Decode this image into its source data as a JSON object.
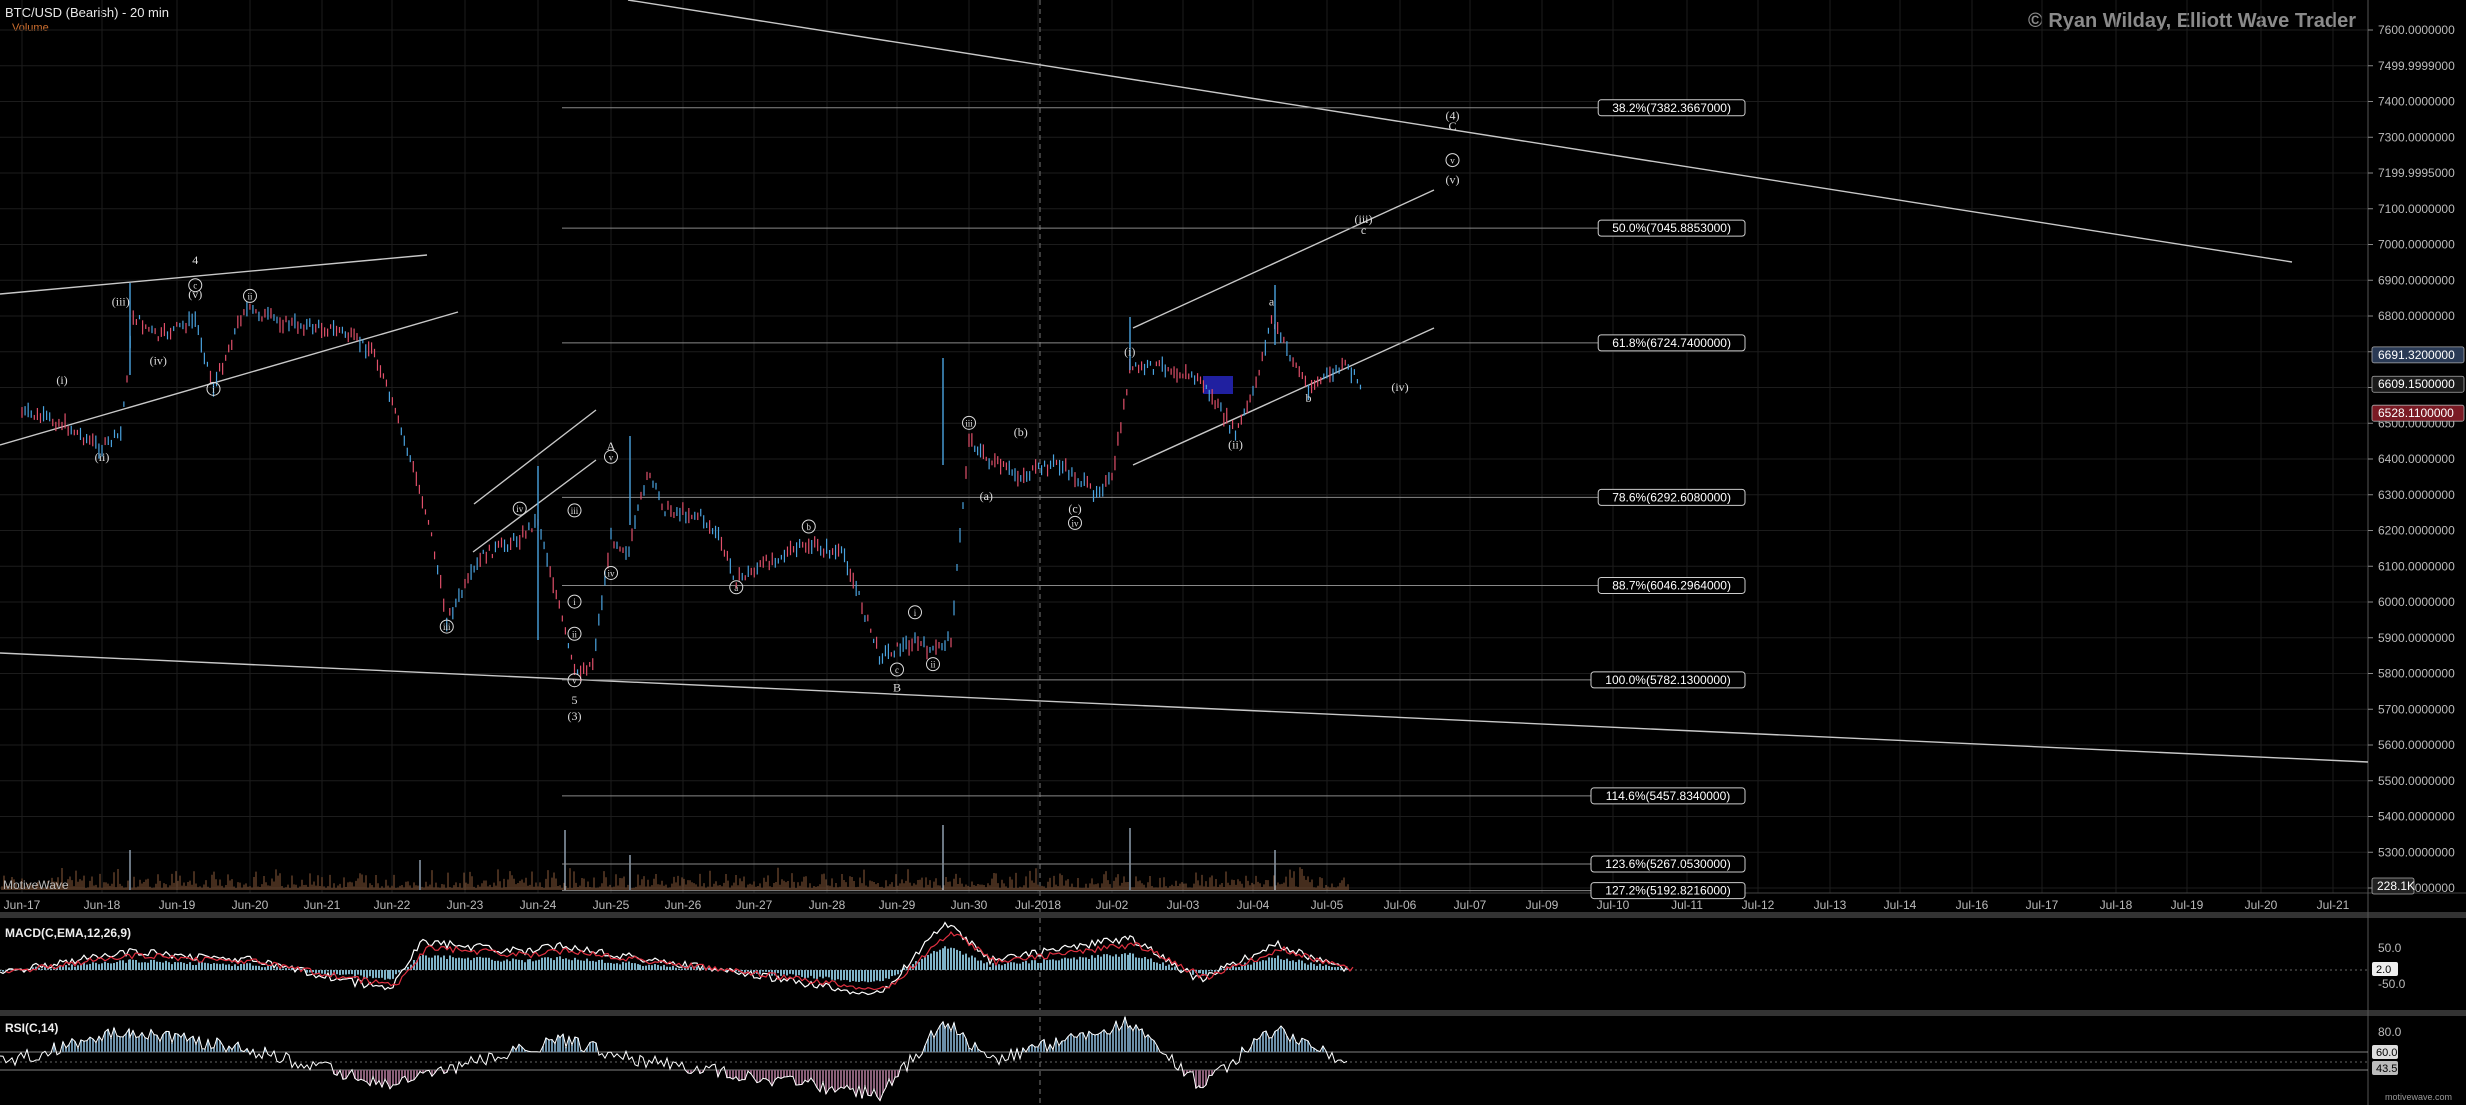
{
  "header": {
    "symbol_title": "BTC/USD (Bearish) - 20 min",
    "volume_label": "Volume",
    "watermark": "© Ryan Wilday, Elliott Wave Trader",
    "brand": "MotiveWave",
    "footer_brand": "motivewave.com"
  },
  "colors": {
    "background": "#000000",
    "grid": "#1c1c1c",
    "candle_up": "#4aa3df",
    "candle_down": "#e0506a",
    "line": "#c8c8c8",
    "fib_text": "#ffffff",
    "macd_line": "#ffffff",
    "macd_signal": "#e03040",
    "macd_hist": "#7fb3c8",
    "rsi_line": "#ffffff",
    "rsi_fill_high": "#6b8fa8",
    "rsi_fill_low": "#8a5f78",
    "volume": "#8a5a3a",
    "blue_box": "#2020a0",
    "price_tag_up": "#2a3a55",
    "price_tag_down": "#7a1a24"
  },
  "chart_data": [
    {
      "type": "line",
      "title": "BTC/USD (Bearish) - 20 min",
      "x_ticks": [
        "Jun-17",
        "Jun-18",
        "Jun-19",
        "Jun-20",
        "Jun-21",
        "Jun-22",
        "Jun-23",
        "Jun-24",
        "Jun-25",
        "Jun-26",
        "Jun-27",
        "Jun-28",
        "Jun-29",
        "Jun-30",
        "Jul-2018",
        "Jul-02",
        "Jul-03",
        "Jul-04",
        "Jul-05",
        "Jul-06",
        "Jul-07",
        "Jul-09",
        "Jul-10",
        "Jul-11",
        "Jul-12",
        "Jul-13",
        "Jul-14",
        "Jul-16",
        "Jul-17",
        "Jul-18",
        "Jul-19",
        "Jul-20",
        "Jul-21"
      ],
      "y_ticks": [
        "7600.0000000",
        "7499.9999000",
        "7400.0000000",
        "7300.0000000",
        "7199.9995000",
        "7100.0000000",
        "7000.0000000",
        "6900.0000000",
        "6800.0000000",
        "6700.0000000",
        "6600.0000000",
        "6500.0000000",
        "6400.0000000",
        "6300.0000000",
        "6200.0000000",
        "6100.0000000",
        "6000.0000000",
        "5900.0000000",
        "5800.0000000",
        "5700.0000000",
        "5600.0000000",
        "5500.0000000",
        "5400.0000000",
        "5300.0000000",
        "5200.0000000"
      ],
      "ylim": [
        5180,
        7640
      ],
      "price_tags": [
        {
          "value": 6691.32,
          "label": "6691.3200000"
        },
        {
          "value": 6609.15,
          "label": "6609.1500000"
        },
        {
          "value": 6528.11,
          "label": "6528.1100000"
        }
      ],
      "volume_tag": "228.1K",
      "fib_levels": [
        {
          "price": 7382.3667,
          "label": "38.2%(7382.3667000)"
        },
        {
          "price": 7045.8853,
          "label": "50.0%(7045.8853000)"
        },
        {
          "price": 6724.74,
          "label": "61.8%(6724.7400000)"
        },
        {
          "price": 6292.608,
          "label": "78.6%(6292.6080000)"
        },
        {
          "price": 6046.2964,
          "label": "88.7%(6046.2964000)"
        },
        {
          "price": 5782.13,
          "label": "100.0%(5782.1300000)"
        },
        {
          "price": 5457.834,
          "label": "114.6%(5457.8340000)"
        },
        {
          "price": 5267.053,
          "label": "123.6%(5267.0530000)"
        },
        {
          "price": 5192.8216,
          "label": "127.2%(5192.8216000)"
        }
      ],
      "price_path": [
        {
          "x": "Jun-17 00:00",
          "y": 6530
        },
        {
          "x": "Jun-17 12:00",
          "y": 6500
        },
        {
          "x": "Jun-18 00:00",
          "y": 6430
        },
        {
          "x": "Jun-18 06:00",
          "y": 6470
        },
        {
          "x": "Jun-18 10:00",
          "y": 6800
        },
        {
          "x": "Jun-18 18:00",
          "y": 6740
        },
        {
          "x": "Jun-19 06:00",
          "y": 6790
        },
        {
          "x": "Jun-19 12:00",
          "y": 6600
        },
        {
          "x": "Jun-19 22:00",
          "y": 6820
        },
        {
          "x": "Jun-20 12:00",
          "y": 6780
        },
        {
          "x": "Jun-21 06:00",
          "y": 6760
        },
        {
          "x": "Jun-21 18:00",
          "y": 6700
        },
        {
          "x": "Jun-22 06:00",
          "y": 6400
        },
        {
          "x": "Jun-22 12:00",
          "y": 6230
        },
        {
          "x": "Jun-22 18:00",
          "y": 5950
        },
        {
          "x": "Jun-23 06:00",
          "y": 6130
        },
        {
          "x": "Jun-23 18:00",
          "y": 6180
        },
        {
          "x": "Jun-24 00:00",
          "y": 6230
        },
        {
          "x": "Jun-24 06:00",
          "y": 6020
        },
        {
          "x": "Jun-24 12:00",
          "y": 5800
        },
        {
          "x": "Jun-24 18:00",
          "y": 5830
        },
        {
          "x": "Jun-25 00:00",
          "y": 6180
        },
        {
          "x": "Jun-25 06:00",
          "y": 6140
        },
        {
          "x": "Jun-25 12:00",
          "y": 6360
        },
        {
          "x": "Jun-25 18:00",
          "y": 6260
        },
        {
          "x": "Jun-26 06:00",
          "y": 6240
        },
        {
          "x": "Jun-26 12:00",
          "y": 6180
        },
        {
          "x": "Jun-26 18:00",
          "y": 6060
        },
        {
          "x": "Jun-27 06:00",
          "y": 6120
        },
        {
          "x": "Jun-27 18:00",
          "y": 6160
        },
        {
          "x": "Jun-28 06:00",
          "y": 6130
        },
        {
          "x": "Jun-28 12:00",
          "y": 5990
        },
        {
          "x": "Jun-28 18:00",
          "y": 5850
        },
        {
          "x": "Jun-29 06:00",
          "y": 5890
        },
        {
          "x": "Jun-29 12:00",
          "y": 5860
        },
        {
          "x": "Jun-29 18:00",
          "y": 5900
        },
        {
          "x": "Jun-30 00:00",
          "y": 6460
        },
        {
          "x": "Jun-30 06:00",
          "y": 6400
        },
        {
          "x": "Jun-30 18:00",
          "y": 6350
        },
        {
          "x": "Jul-2018 06:00",
          "y": 6390
        },
        {
          "x": "Jul-2018 18:00",
          "y": 6310
        },
        {
          "x": "Jul-02 00:00",
          "y": 6340
        },
        {
          "x": "Jul-02 06:00",
          "y": 6650
        },
        {
          "x": "Jul-02 18:00",
          "y": 6660
        },
        {
          "x": "Jul-03 06:00",
          "y": 6620
        },
        {
          "x": "Jul-03 18:00",
          "y": 6470
        },
        {
          "x": "Jul-04 00:00",
          "y": 6580
        },
        {
          "x": "Jul-04 06:00",
          "y": 6790
        },
        {
          "x": "Jul-04 12:00",
          "y": 6690
        },
        {
          "x": "Jul-04 18:00",
          "y": 6600
        },
        {
          "x": "Jul-05 06:00",
          "y": 6660
        },
        {
          "x": "Jul-05 12:00",
          "y": 6600
        }
      ],
      "wave_labels": [
        {
          "x": "Jun-17 12:00",
          "y": 6610,
          "text": "(i)"
        },
        {
          "x": "Jun-18 00:00",
          "y": 6395,
          "text": "(ii)"
        },
        {
          "x": "Jun-18 06:00",
          "y": 6830,
          "text": "(iii)"
        },
        {
          "x": "Jun-18 18:00",
          "y": 6665,
          "text": "(iv)"
        },
        {
          "x": "Jun-19 06:00",
          "y": 6850,
          "text": "(v)"
        },
        {
          "x": "Jun-19 06:00",
          "y": 6875,
          "text": "c",
          "circled": true
        },
        {
          "x": "Jun-19 06:00",
          "y": 6945,
          "text": "4"
        },
        {
          "x": "Jun-19 12:00",
          "y": 6585,
          "text": "i",
          "circled": true
        },
        {
          "x": "Jun-20 00:00",
          "y": 6845,
          "text": "ii",
          "circled": true
        },
        {
          "x": "Jun-22 18:00",
          "y": 5920,
          "text": "iii",
          "circled": true
        },
        {
          "x": "Jun-23 18:00",
          "y": 6250,
          "text": "iv",
          "circled": true
        },
        {
          "x": "Jun-24 12:00",
          "y": 6245,
          "text": "iii",
          "circled": true
        },
        {
          "x": "Jun-24 12:00",
          "y": 5990,
          "text": "i",
          "circled": true
        },
        {
          "x": "Jun-24 12:00",
          "y": 5900,
          "text": "ii",
          "circled": true
        },
        {
          "x": "Jun-24 12:00",
          "y": 5770,
          "text": "v",
          "circled": true
        },
        {
          "x": "Jun-24 12:00",
          "y": 5715,
          "text": "5"
        },
        {
          "x": "Jun-24 12:00",
          "y": 5670,
          "text": "(3)"
        },
        {
          "x": "Jun-25 00:00",
          "y": 6425,
          "text": "A"
        },
        {
          "x": "Jun-25 00:00",
          "y": 6395,
          "text": "v",
          "circled": true
        },
        {
          "x": "Jun-25 00:00",
          "y": 6070,
          "text": "iv",
          "circled": true
        },
        {
          "x": "Jun-26 18:00",
          "y": 6030,
          "text": "a",
          "circled": true
        },
        {
          "x": "Jun-27 18:00",
          "y": 6200,
          "text": "b",
          "circled": true
        },
        {
          "x": "Jun-29 06:00",
          "y": 5960,
          "text": "i",
          "circled": true
        },
        {
          "x": "Jun-29 00:00",
          "y": 5800,
          "text": "c",
          "circled": true
        },
        {
          "x": "Jun-29 00:00",
          "y": 5750,
          "text": "B"
        },
        {
          "x": "Jun-29 12:00",
          "y": 5815,
          "text": "ii",
          "circled": true
        },
        {
          "x": "Jun-30 00:00",
          "y": 6490,
          "text": "iii",
          "circled": true
        },
        {
          "x": "Jun-30 18:00",
          "y": 6465,
          "text": "(b)"
        },
        {
          "x": "Jun-30 06:00",
          "y": 6285,
          "text": "(a)"
        },
        {
          "x": "Jul-2018 12:00",
          "y": 6250,
          "text": "(c)"
        },
        {
          "x": "Jul-2018 12:00",
          "y": 6210,
          "text": "iv",
          "circled": true
        },
        {
          "x": "Jul-02 06:00",
          "y": 6690,
          "text": "(i)"
        },
        {
          "x": "Jul-03 18:00",
          "y": 6430,
          "text": "(ii)"
        },
        {
          "x": "Jul-04 06:00",
          "y": 6830,
          "text": "a"
        },
        {
          "x": "Jul-04 18:00",
          "y": 6560,
          "text": "b"
        },
        {
          "x": "Jul-06 00:00",
          "y": 6590,
          "text": "(iv)"
        },
        {
          "x": "Jul-05 12:00",
          "y": 7060,
          "text": "(iii)"
        },
        {
          "x": "Jul-05 12:00",
          "y": 7030,
          "text": "c"
        },
        {
          "x": "Jul-06 18:00",
          "y": 7350,
          "text": "(4)"
        },
        {
          "x": "Jul-06 18:00",
          "y": 7320,
          "text": "C"
        },
        {
          "x": "Jul-06 18:00",
          "y": 7225,
          "text": "v",
          "circled": true
        },
        {
          "x": "Jul-06 18:00",
          "y": 7170,
          "text": "(v)"
        }
      ]
    },
    {
      "type": "line",
      "title": "MACD(C,EMA,12,26,9)",
      "y_ticks": [
        "50.0",
        "-50.0"
      ],
      "value_tag": "2.0"
    },
    {
      "type": "line",
      "title": "RSI(C,14)",
      "y_ticks": [
        "80.0"
      ],
      "value_tags": [
        "60.0",
        "43.5"
      ]
    }
  ]
}
